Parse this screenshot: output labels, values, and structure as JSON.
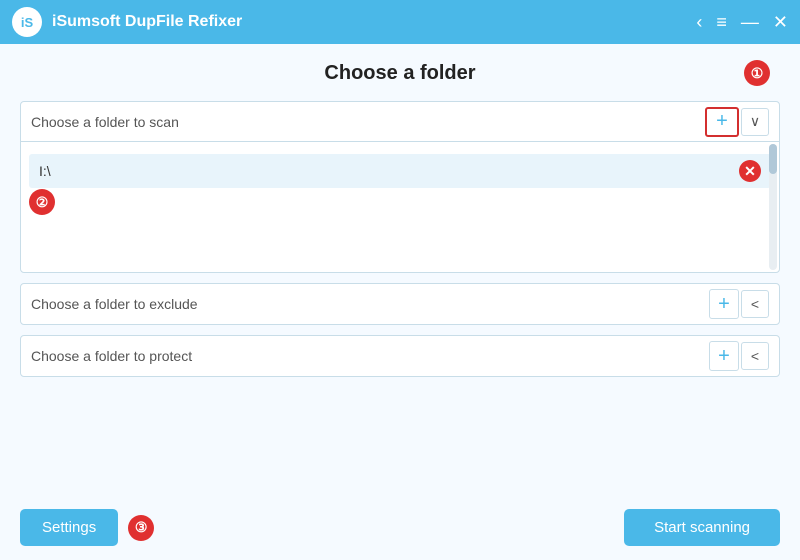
{
  "titleBar": {
    "appTitle": "iSumsoft DupFile Refixer",
    "logoText": "iS",
    "shareIcon": "⟨",
    "menuIcon": "≡",
    "minimizeIcon": "—",
    "closeIcon": "✕"
  },
  "pageTitle": "Choose a folder",
  "stepBadge1": "❶",
  "stepBadge2": "❷",
  "stepBadge3": "❸",
  "scanFolder": {
    "label": "Choose a folder to scan",
    "addLabel": "+",
    "collapseLabel": "∨",
    "items": [
      {
        "path": "I:\\"
      }
    ],
    "removeLabel": "✕"
  },
  "excludeFolder": {
    "label": "Choose a folder to exclude",
    "addLabel": "+",
    "collapseLabel": "<"
  },
  "protectFolder": {
    "label": "Choose a folder to protect",
    "addLabel": "+",
    "collapseLabel": "<"
  },
  "footer": {
    "settingsLabel": "Settings",
    "startScanLabel": "Start scanning"
  }
}
